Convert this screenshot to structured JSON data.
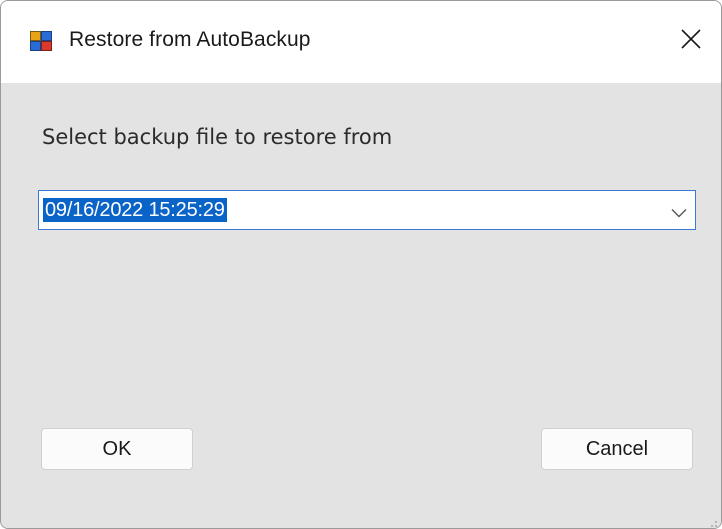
{
  "window": {
    "title": "Restore from AutoBackup",
    "icon": "app-window-icon",
    "close_icon": "close-icon"
  },
  "dialog": {
    "prompt": "Select backup file to restore from",
    "backup_select": {
      "selected_value": "09/16/2022 15:25:29",
      "icon": "chevron-down-icon"
    },
    "ok_label": "OK",
    "cancel_label": "Cancel"
  },
  "colors": {
    "dialog_background": "#e3e3e3",
    "titlebar_background": "#ffffff",
    "selection_highlight": "#0a64c8",
    "combo_focus_border": "#3b7bd8"
  }
}
